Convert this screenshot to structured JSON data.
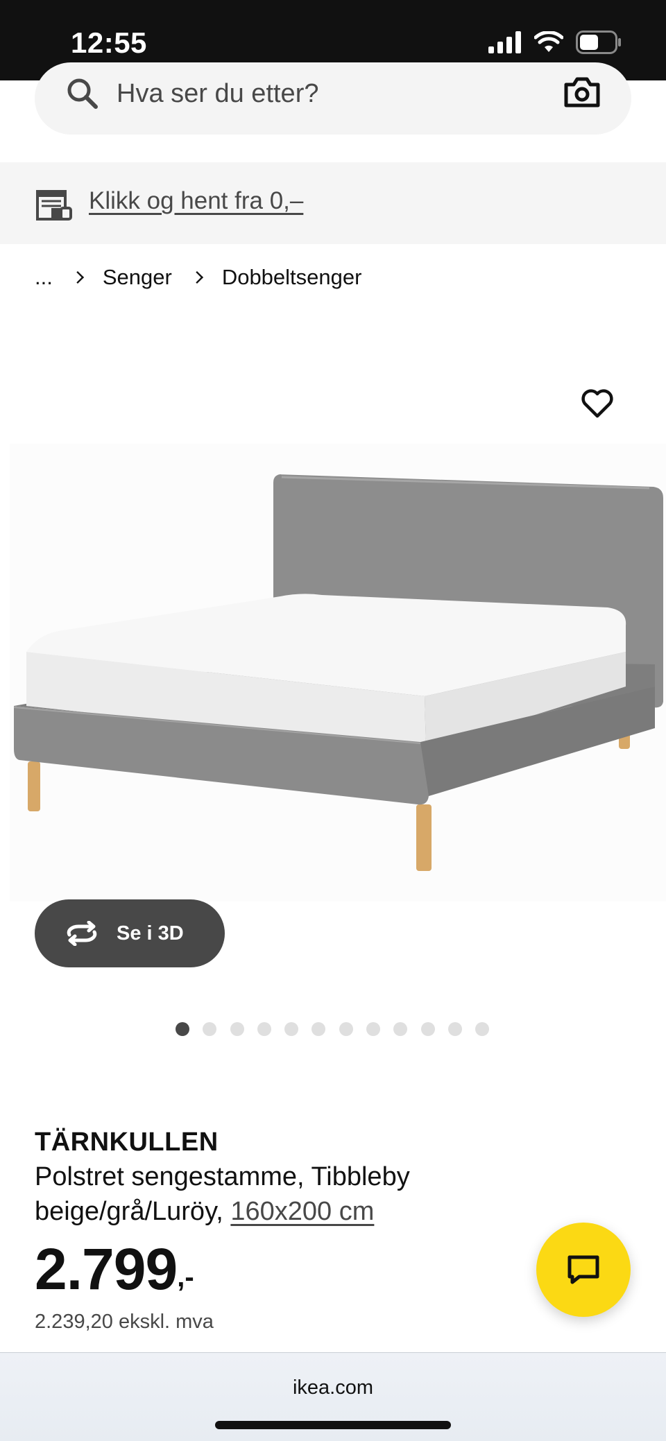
{
  "status_bar": {
    "time": "12:55",
    "icons": [
      "signal-icon",
      "wifi-icon",
      "battery-icon"
    ]
  },
  "search": {
    "placeholder": "Hva ser du etter?",
    "icons": [
      "search-icon",
      "camera-icon"
    ]
  },
  "promo": {
    "text": "Klikk og hent fra 0,–",
    "icon": "store-pickup-icon"
  },
  "breadcrumb": {
    "items": [
      "...",
      "Senger",
      "Dobbeltsenger"
    ]
  },
  "gallery": {
    "favorite_icon": "heart-icon",
    "image": "bed-product-image",
    "view_3d_label": "Se i 3D",
    "dot_count": 12,
    "active_dot": 0
  },
  "product": {
    "name": "TÄRNKULLEN",
    "description": "Polstret sengestamme, Tibbleby beige/grå/Luröy,",
    "size": "160x200 cm",
    "price_main": "2.799",
    "price_suffix": ",-",
    "price_excl_vat": "2.239,20 ekskl. mva"
  },
  "chat": {
    "icon": "chat-icon",
    "color": "#fbd914"
  },
  "browser": {
    "url": "ikea.com"
  },
  "colors": {
    "status_bar": "#111111",
    "dark_grey": "#484848",
    "light_grey": "#f5f5f5",
    "ikea_yellow": "#fbd914"
  }
}
